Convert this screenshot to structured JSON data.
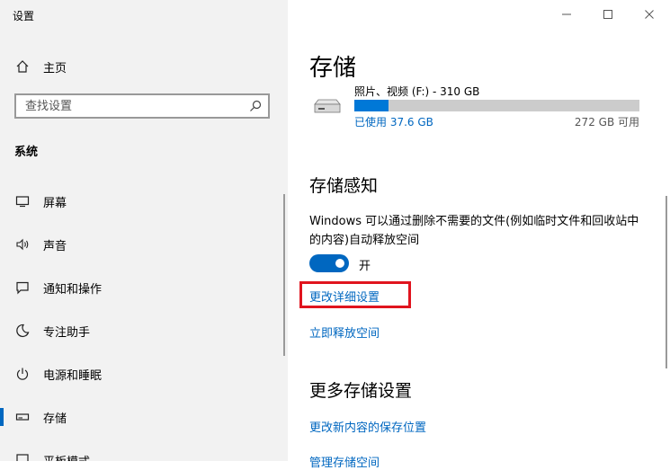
{
  "app": {
    "title": "设置"
  },
  "sidebar": {
    "home_label": "主页",
    "search_placeholder": "查找设置",
    "section_title": "系统",
    "items": [
      {
        "label": "屏幕",
        "icon": "display-icon",
        "selected": false
      },
      {
        "label": "声音",
        "icon": "speaker-icon",
        "selected": false
      },
      {
        "label": "通知和操作",
        "icon": "notification-icon",
        "selected": false
      },
      {
        "label": "专注助手",
        "icon": "moon-icon",
        "selected": false
      },
      {
        "label": "电源和睡眠",
        "icon": "power-icon",
        "selected": false
      },
      {
        "label": "存储",
        "icon": "storage-icon",
        "selected": true
      },
      {
        "label": "平板模式",
        "icon": "tablet-icon",
        "selected": false
      }
    ]
  },
  "window_controls": {
    "minimize": "minimize-icon",
    "maximize": "maximize-icon",
    "close": "close-icon"
  },
  "main": {
    "title": "存储",
    "drive": {
      "name": "照片、视频 (F:) - 310 GB",
      "used_label": "已使用 37.6 GB",
      "free_label": "272 GB 可用",
      "used_fraction": 0.121
    },
    "storage_sense": {
      "heading": "存储感知",
      "description": "Windows 可以通过删除不需要的文件(例如临时文件和回收站中的内容)自动释放空间",
      "toggle_state": "开",
      "toggle_on": true,
      "change_settings_link": "更改详细设置",
      "free_now_link": "立即释放空间"
    },
    "more_settings": {
      "heading": "更多存储设置",
      "link1": "更改新内容的保存位置",
      "link2": "管理存储空间"
    }
  },
  "colors": {
    "accent": "#0067c0",
    "highlight": "#e0141e",
    "sidebar_bg": "#f2f2f2"
  }
}
